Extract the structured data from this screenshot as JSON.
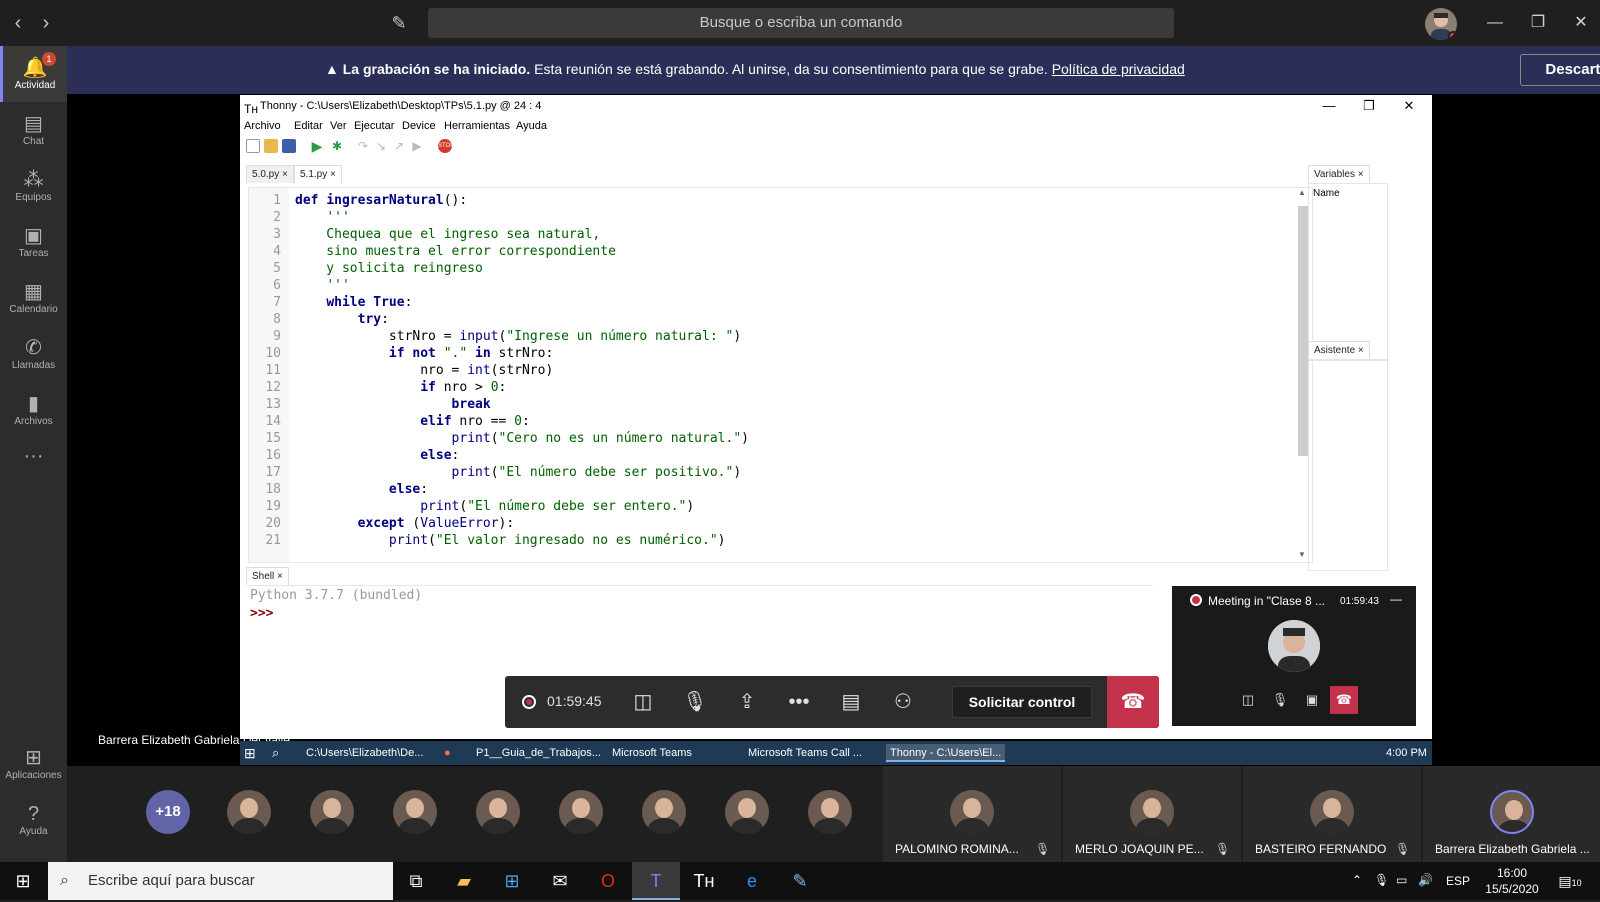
{
  "teams": {
    "search_placeholder": "Busque o escriba un comando",
    "sidebar": [
      {
        "label": "Actividad",
        "icon": "bell-icon",
        "badge": "1",
        "active": true
      },
      {
        "label": "Chat",
        "icon": "chat-icon"
      },
      {
        "label": "Equipos",
        "icon": "teams-icon"
      },
      {
        "label": "Tareas",
        "icon": "assignments-icon"
      },
      {
        "label": "Calendario",
        "icon": "calendar-icon"
      },
      {
        "label": "Llamadas",
        "icon": "phone-icon"
      },
      {
        "label": "Archivos",
        "icon": "files-icon"
      },
      {
        "label": "Aplicaciones",
        "icon": "apps-icon"
      },
      {
        "label": "Ayuda",
        "icon": "help-icon"
      }
    ],
    "banner": {
      "bold": "La grabación se ha iniciado.",
      "text": " Esta reunión se está grabando. Al unirse, da su consentimiento para que se grabe. ",
      "link": "Política de privacidad",
      "dismiss": "Descartar"
    }
  },
  "thonny": {
    "title": "Thonny  -  C:\\Users\\Elizabeth\\Desktop\\TPs\\5.1.py  @  24 : 4",
    "menu": [
      "Archivo",
      "Editar",
      "Ver",
      "Ejecutar",
      "Device",
      "Herramientas",
      "Ayuda"
    ],
    "tabs": [
      "5.0.py",
      "5.1.py"
    ],
    "code_lines": [
      "def ingresarNatural():",
      "    '''",
      "    Chequea que el ingreso sea natural,",
      "    sino muestra el error correspondiente",
      "    y solicita reingreso",
      "    '''",
      "    while True:",
      "        try:",
      "            strNro = input(\"Ingrese un número natural: \")",
      "            if not \".\" in strNro:",
      "                nro = int(strNro)",
      "                if nro > 0:",
      "                    break",
      "                elif nro == 0:",
      "                    print(\"Cero no es un número natural.\")",
      "                else:",
      "                    print(\"El número debe ser positivo.\")",
      "            else:",
      "                print(\"El número debe ser entero.\")",
      "        except (ValueError):",
      "            print(\"El valor ingresado no es numérico.\")"
    ],
    "line_numbers": [
      "1",
      "2",
      "3",
      "4",
      "5",
      "6",
      "7",
      "8",
      "9",
      "10",
      "11",
      "12",
      "13",
      "14",
      "15",
      "16",
      "17",
      "18",
      "19",
      "20",
      "21"
    ],
    "variables_tab": "Variables",
    "variables_header": "Name",
    "assistant_tab": "Asistente",
    "shell_tab": "Shell",
    "shell_banner": "Python 3.7.7 (bundled)",
    "shell_prompt": ">>>"
  },
  "meeting": {
    "timer": "01:59:45",
    "request_control": "Solicitar control",
    "mini_title": "Meeting in \"Clase 8 ...",
    "mini_timer": "01:59:43",
    "presenter": "Barrera Elizabeth Gabriela Del Valle",
    "more_participants": "+18",
    "named_participants": [
      "PALOMINO ROMINA...",
      "MERLO JOAQUIN PE...",
      "BASTEIRO FERNANDO",
      "Barrera Elizabeth Gabriela ..."
    ]
  },
  "inner_taskbar": {
    "items": [
      "C:\\Users\\Elizabeth\\De...",
      "P1__Guia_de_Trabajos...",
      "Microsoft Teams",
      "Microsoft Teams Call ...",
      "Thonny  -  C:\\Users\\El..."
    ],
    "clock": "4:00 PM"
  },
  "taskbar": {
    "search_placeholder": "Escribe aquí para buscar",
    "language": "ESP",
    "time": "16:00",
    "date": "15/5/2020",
    "notifications": "10"
  }
}
